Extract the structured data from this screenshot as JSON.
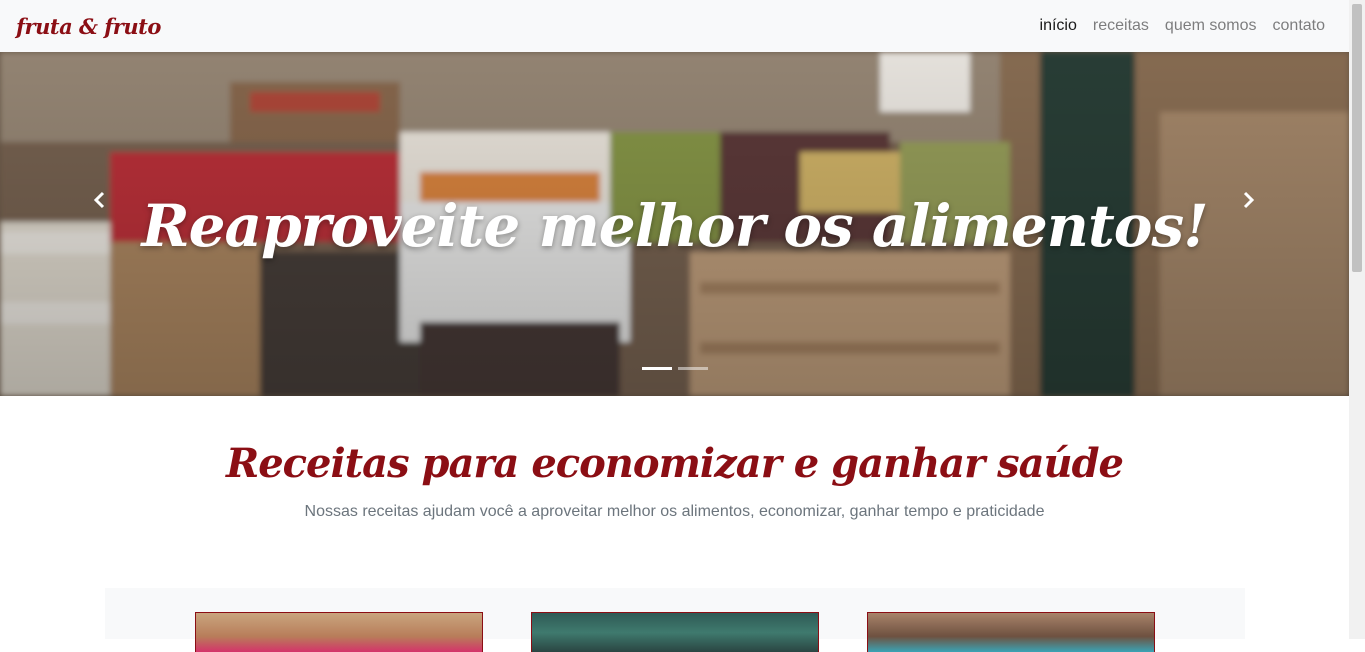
{
  "navbar": {
    "brand": "fruta & fruto",
    "links": [
      {
        "label": "início",
        "active": true
      },
      {
        "label": "receitas",
        "active": false
      },
      {
        "label": "quem somos",
        "active": false
      },
      {
        "label": "contato",
        "active": false
      }
    ]
  },
  "carousel": {
    "caption": "Reaproveite melhor os alimentos!",
    "slide_count": 2,
    "active_slide": 1,
    "prev_icon": "chevron-left-icon",
    "next_icon": "chevron-right-icon"
  },
  "section": {
    "title": "Receitas para economizar e ganhar saúde",
    "subtitle": "Nossas receitas ajudam você a aproveitar melhor os alimentos, economizar, ganhar tempo e praticidade"
  },
  "colors": {
    "brand": "#8b0e14",
    "navbar_bg": "#f8f9fa",
    "muted_text": "#6c757d"
  }
}
